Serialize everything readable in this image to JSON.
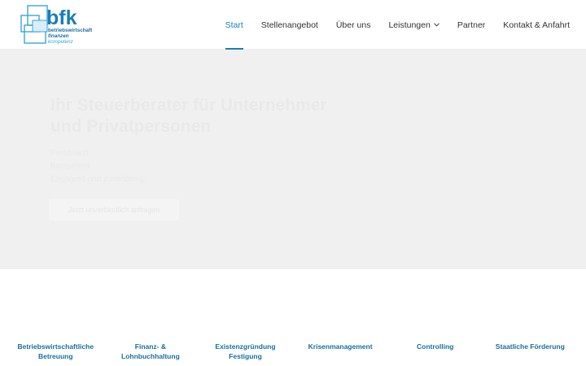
{
  "logo": {
    "brand": "bfk",
    "line1": "betriebswirtschaft",
    "line2": "finanzen",
    "line3": "kompetenz"
  },
  "nav": {
    "items": [
      {
        "label": "Start",
        "active": true
      },
      {
        "label": "Stellenangebot"
      },
      {
        "label": "Über uns"
      },
      {
        "label": "Leistungen",
        "has_dropdown": true
      },
      {
        "label": "Partner"
      },
      {
        "label": "Kontakt & Anfahrt"
      }
    ]
  },
  "hero": {
    "title": "Ihr Steuerberater für Unternehmer und Privatpersonen",
    "line1": "Persönlich.",
    "line2": "Kompetent.",
    "line3": "Engagiert und zuverlässig.",
    "button": "Jetzt unverbindlich anfragen"
  },
  "services": [
    {
      "line1": "Betriebswirtschaftliche",
      "line2": "Betreuung"
    },
    {
      "line1": "Finanz- &",
      "line2": "Lohnbuchhaltung"
    },
    {
      "line1": "Existenzgründung",
      "line2": "Festigung"
    },
    {
      "line1": "Krisenmanagement",
      "line2": ""
    },
    {
      "line1": "Controlling",
      "line2": ""
    },
    {
      "line1": "Staatliche Förderung",
      "line2": ""
    }
  ],
  "colors": {
    "accent": "#1a7fb4",
    "service_text": "#1a6e9e",
    "hero_bg": "#f0f0f0"
  }
}
